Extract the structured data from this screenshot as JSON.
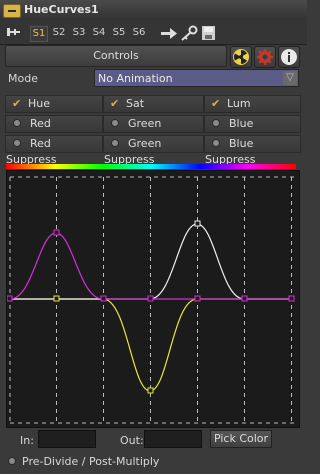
{
  "window": {
    "title": "HueCurves1"
  },
  "toolbar": {
    "slots": [
      "S1",
      "S2",
      "S3",
      "S4",
      "S5",
      "S6"
    ],
    "active_slot": "S1"
  },
  "controls": {
    "tab_label": "Controls"
  },
  "mode": {
    "label": "Mode",
    "value": "No Animation"
  },
  "channels": {
    "checks": [
      {
        "label": "Hue",
        "checked": true
      },
      {
        "label": "Sat",
        "checked": true
      },
      {
        "label": "Lum",
        "checked": true
      }
    ],
    "radios_row1": [
      "Red",
      "Green",
      "Blue"
    ],
    "radios_row2": [
      "Red Suppress",
      "Green Suppress",
      "Blue Suppress"
    ]
  },
  "bottom": {
    "in_label": "In:",
    "out_label": "Out:",
    "pick_color_label": "Pick Color",
    "premultiply_label": "Pre-Divide / Post-Multiply"
  },
  "colors": {
    "accent": "#d9b54b",
    "hue_curve": "#d62fd6",
    "sat_curve": "#e6e63a",
    "lum_curve": "#eeeeee",
    "mode_field": "#5b5b87"
  }
}
